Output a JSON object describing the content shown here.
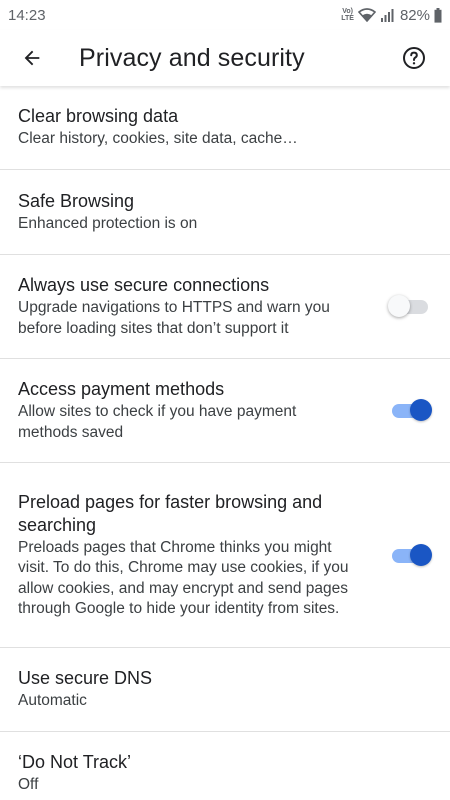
{
  "status_bar": {
    "time": "14:23",
    "network_label_top": "Vo)",
    "network_label_bottom": "LTE",
    "battery": "82%"
  },
  "app_bar": {
    "title": "Privacy and security",
    "back_icon": "arrow-back-icon",
    "help_icon": "help-circle-icon"
  },
  "settings": [
    {
      "title": "Clear browsing data",
      "summary": "Clear history, cookies, site data, cache…"
    },
    {
      "title": "Safe Browsing",
      "summary": "Enhanced protection is on"
    },
    {
      "title": "Always use secure connections",
      "summary": "Upgrade navigations to HTTPS and warn you before loading sites that don’t support it",
      "toggle": "off"
    },
    {
      "title": "Access payment methods",
      "summary": "Allow sites to check if you have payment methods saved",
      "toggle": "on"
    },
    {
      "title": "Preload pages for faster browsing and searching",
      "summary": "Preloads pages that Chrome thinks you might visit. To do this, Chrome may use cookies, if you allow cookies, and may encrypt and send pages through Google to hide your identity from sites.",
      "toggle": "on"
    },
    {
      "title": "Use secure DNS",
      "summary": "Automatic"
    },
    {
      "title": "‘Do Not Track’",
      "summary": "Off"
    }
  ],
  "colors": {
    "toggle_on_track": "#8ab4f8",
    "toggle_on_knob": "#1a56c4",
    "toggle_off_track": "#dadce0",
    "divider": "#e0e0e0"
  }
}
